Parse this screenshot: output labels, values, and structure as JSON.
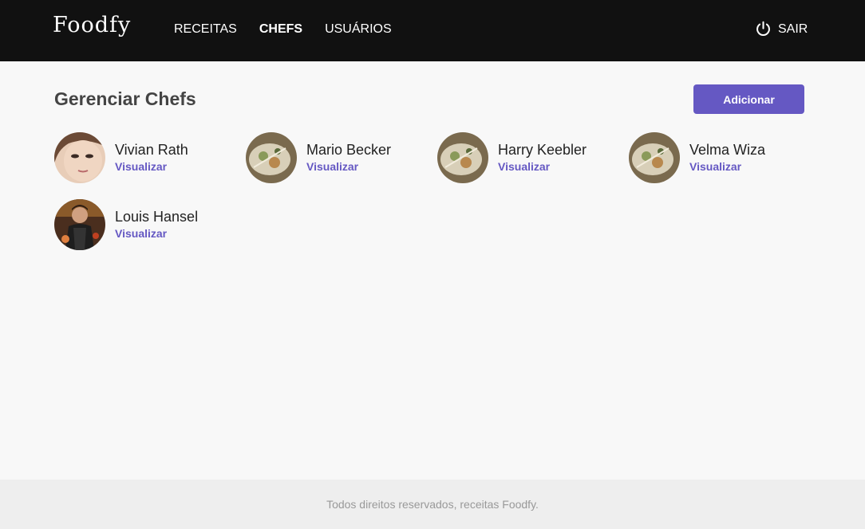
{
  "header": {
    "logo": "Foodfy",
    "nav": [
      {
        "label": "RECEITAS",
        "active": false
      },
      {
        "label": "CHEFS",
        "active": true
      },
      {
        "label": "USUÁRIOS",
        "active": false
      }
    ],
    "logout_label": "SAIR",
    "logout_icon": "power-icon"
  },
  "main": {
    "title": "Gerenciar Chefs",
    "add_label": "Adicionar",
    "chefs": [
      {
        "name": "Vivian Rath",
        "link": "Visualizar",
        "avatar": "woman-portrait-photo"
      },
      {
        "name": "Mario Becker",
        "link": "Visualizar",
        "avatar": "food-platter-photo"
      },
      {
        "name": "Harry Keebler",
        "link": "Visualizar",
        "avatar": "food-platter-photo"
      },
      {
        "name": "Velma Wiza",
        "link": "Visualizar",
        "avatar": "food-platter-photo"
      },
      {
        "name": "Louis Hansel",
        "link": "Visualizar",
        "avatar": "chef-cooking-photo"
      }
    ]
  },
  "footer": {
    "text": "Todos direitos reservados, receitas Foodfy."
  },
  "colors": {
    "header_bg": "#111111",
    "accent": "#6558c3",
    "page_bg": "#f8f8f8",
    "footer_bg": "#eeeeee",
    "title": "#444444",
    "footer_text": "#999999"
  }
}
